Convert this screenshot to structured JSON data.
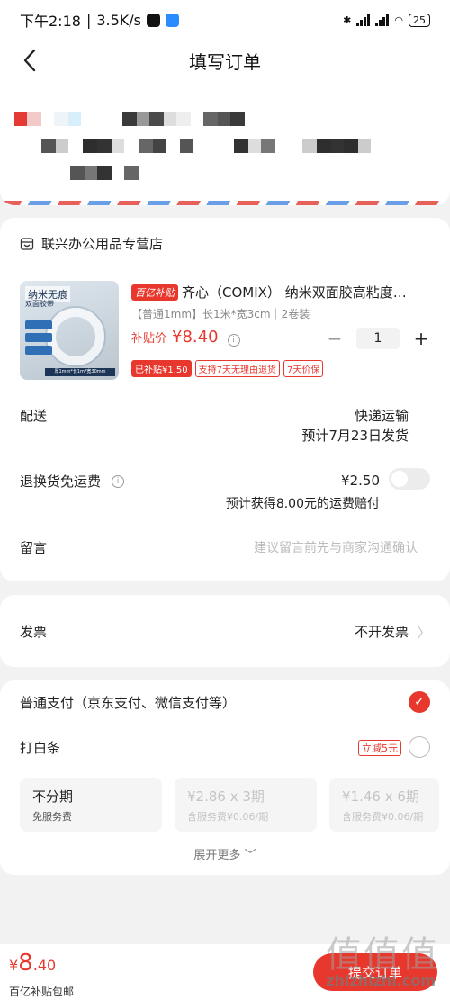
{
  "status_bar": {
    "time": "下午2:18",
    "speed": "3.5K/s",
    "battery": "25"
  },
  "nav": {
    "title": "填写订单"
  },
  "store": {
    "name": "联兴办公用品专营店"
  },
  "product": {
    "badge": "百亿补贴",
    "title": "齐心（COMIX） 纳米双面胶高粘度…",
    "spec": "【普通1mm】长1米*宽3cm｜2卷装",
    "price_label": "补贴价",
    "price": "¥8.40",
    "quantity": "1",
    "image_text1": "纳米无痕",
    "image_text2": "双面胶带",
    "image_bar": "厚1mm*长1m*宽30mm",
    "tags": [
      "已补贴¥1.50",
      "支持7天无理由退货",
      "7天价保"
    ]
  },
  "delivery": {
    "label": "配送",
    "method": "快递运输",
    "eta": "预计7月23日发货"
  },
  "return_shipping": {
    "label": "退换货免运费",
    "price": "¥2.50",
    "note": "预计获得8.00元的运费赔付"
  },
  "remark": {
    "label": "留言",
    "placeholder": "建议留言前先与商家沟通确认"
  },
  "invoice": {
    "label": "发票",
    "value": "不开发票"
  },
  "payment": {
    "normal_label": "普通支付（京东支付、微信支付等）",
    "baitiao_label": "打白条",
    "promo": "立减5元",
    "installments": [
      {
        "title": "不分期",
        "sub": "免服务费"
      },
      {
        "title": "¥2.86 x 3期",
        "sub": "含服务费¥0.06/期"
      },
      {
        "title": "¥1.46 x 6期",
        "sub": "含服务费¥0.06/期"
      }
    ],
    "expand": "展开更多"
  },
  "bottom": {
    "yen": "¥",
    "integer": "8",
    "decimal": ".40",
    "note": "百亿补贴包邮",
    "submit": "提交订单"
  },
  "watermark": {
    "text": "值值值",
    "url": "zhizhizhi.com"
  }
}
